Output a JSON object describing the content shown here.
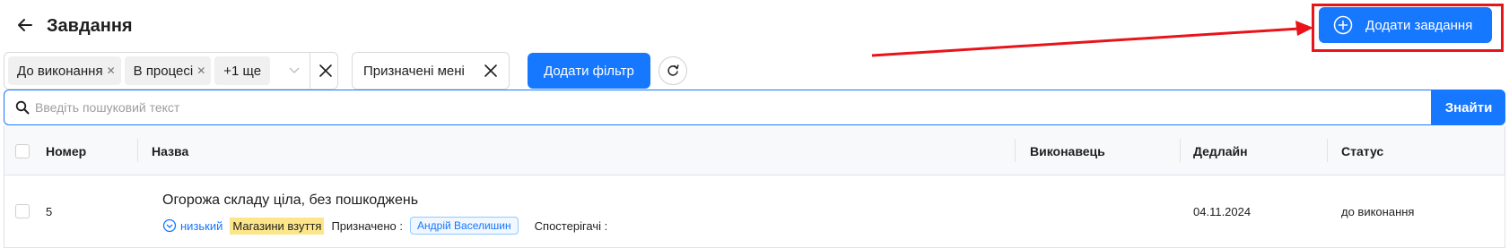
{
  "header": {
    "title": "Завдання",
    "add_task_label": "Додати завдання"
  },
  "filters": {
    "status_tags": [
      "До виконання",
      "В процесі"
    ],
    "status_more": "+1 ще",
    "assigned_label": "Призначені мені",
    "add_filter_label": "Додати фільтр"
  },
  "search": {
    "placeholder": "Введіть пошуковий текст",
    "value": "",
    "button_label": "Знайти"
  },
  "table": {
    "columns": {
      "number": "Номер",
      "name": "Назва",
      "assignee": "Виконавець",
      "deadline": "Дедлайн",
      "status": "Статус"
    },
    "rows": [
      {
        "number": "5",
        "title": "Огорожа складу ціла, без пошкоджень",
        "priority": "низький",
        "store": "Магазини взуття",
        "assigned_label": "Призначено",
        "assignee": "Андрій Васелишин",
        "watchers_label": "Спостерігачі",
        "executor": "",
        "deadline": "04.11.2024",
        "status": "до виконання"
      }
    ]
  },
  "colors": {
    "accent": "#1677ff",
    "highlight_box": "#e8141a",
    "store_tag": "#fde68a"
  },
  "icons": {
    "back": "arrow-left-icon",
    "add": "plus-circle-icon",
    "tag_remove": "close-icon",
    "select": "chevron-down-icon",
    "reset": "refresh-icon",
    "search": "search-icon",
    "priority": "chevron-down-circle-icon"
  }
}
